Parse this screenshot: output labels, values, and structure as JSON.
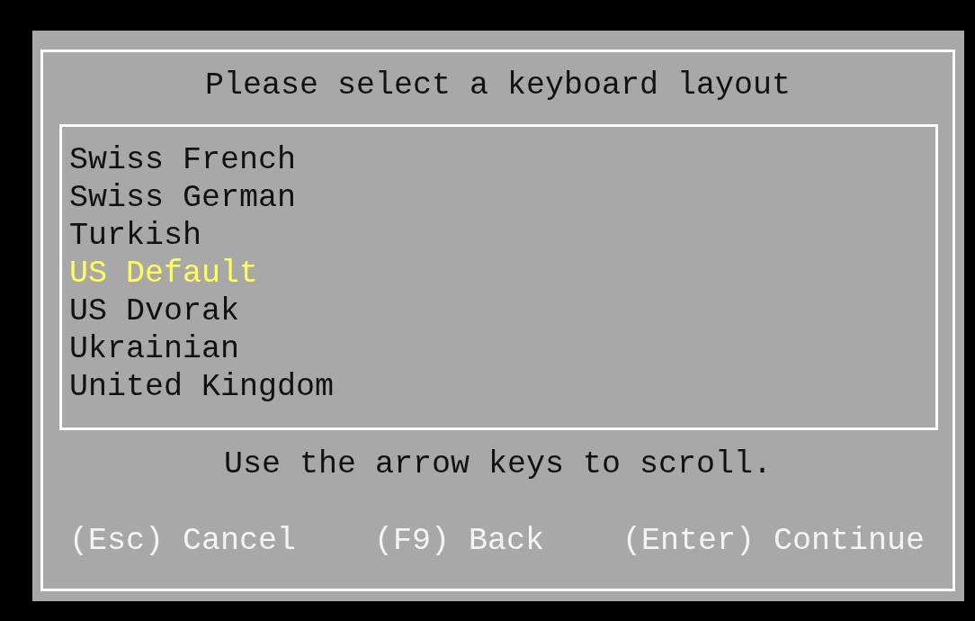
{
  "dialog": {
    "title": "Please select a keyboard layout",
    "layouts": [
      {
        "label": "Swiss French",
        "selected": false
      },
      {
        "label": "Swiss German",
        "selected": false
      },
      {
        "label": "Turkish",
        "selected": false
      },
      {
        "label": "US Default",
        "selected": true
      },
      {
        "label": "US Dvorak",
        "selected": false
      },
      {
        "label": "Ukrainian",
        "selected": false
      },
      {
        "label": "United Kingdom",
        "selected": false
      }
    ],
    "hint": "Use the arrow keys to scroll.",
    "actions": [
      {
        "label": "(Esc) Cancel"
      },
      {
        "label": "(F9) Back"
      },
      {
        "label": "(Enter) Continue"
      }
    ]
  }
}
